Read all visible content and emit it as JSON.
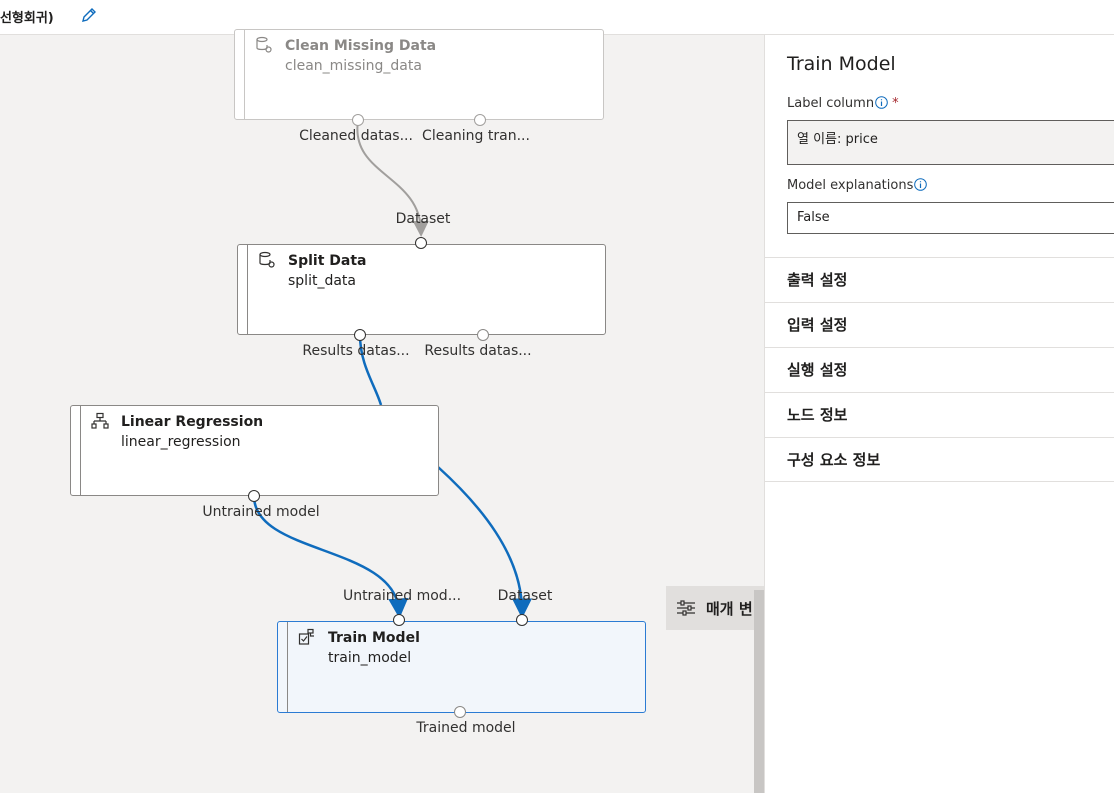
{
  "header": {
    "title": "(선형회귀)",
    "edit_icon": "pencil-icon"
  },
  "canvas": {
    "nodes": [
      {
        "title": "Clean Missing Data",
        "name": "clean_missing_data",
        "icon": "dataset-gear-icon",
        "outputs": [
          "Cleaned datas...",
          "Cleaning tran..."
        ]
      },
      {
        "title": "Split Data",
        "name": "split_data",
        "icon": "dataset-gear-icon",
        "inputs": [
          "Dataset"
        ],
        "outputs": [
          "Results datas...",
          "Results datas..."
        ]
      },
      {
        "title": "Linear Regression",
        "name": "linear_regression",
        "icon": "hierarchy-icon",
        "outputs": [
          "Untrained model"
        ]
      },
      {
        "title": "Train Model",
        "name": "train_model",
        "icon": "train-model-icon",
        "inputs": [
          "Untrained mod...",
          "Dataset"
        ],
        "outputs": [
          "Trained model"
        ]
      }
    ],
    "parameters_button": {
      "label": "매개 변",
      "icon": "sliders-icon"
    }
  },
  "panel": {
    "title": "Train Model",
    "label_column": {
      "label": "Label column",
      "required_mark": "*",
      "value": "열 이름: price"
    },
    "model_explanations": {
      "label": "Model explanations",
      "value": "False"
    },
    "sections": [
      "출력 설정",
      "입력 설정",
      "실행 설정",
      "노드 정보",
      "구성 요소 정보"
    ]
  },
  "colors": {
    "accent": "#0f6cbd",
    "selected_border": "#2b7bd3",
    "selected_bg": "#f2f6fb"
  }
}
